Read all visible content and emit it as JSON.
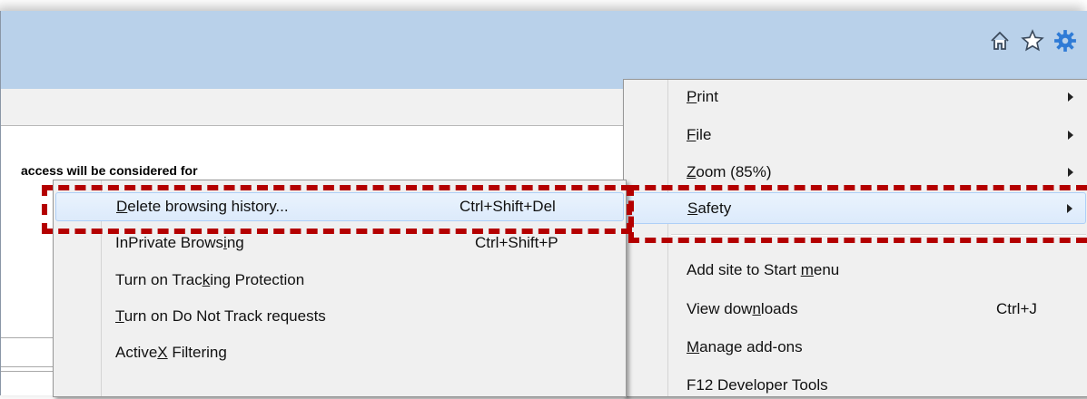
{
  "page": {
    "text": "access will be considered for"
  },
  "toolbar": {
    "icons": [
      "home-icon",
      "star-icon",
      "gear-icon"
    ]
  },
  "menu": {
    "items": [
      {
        "label": "Print",
        "submenu": true
      },
      {
        "label": "File",
        "submenu": true
      },
      {
        "label": "Zoom (85%)",
        "submenu": true
      },
      {
        "label": "Safety",
        "submenu": true
      },
      {
        "label": "Add site to Start menu"
      },
      {
        "label": "View downloads",
        "shortcut": "Ctrl+J"
      },
      {
        "label": "Manage add-ons"
      },
      {
        "label": "F12 Developer Tools"
      }
    ]
  },
  "submenu": {
    "items": [
      {
        "label": "Delete browsing history...",
        "shortcut": "Ctrl+Shift+Del"
      },
      {
        "label": "InPrivate Browsing",
        "shortcut": "Ctrl+Shift+P"
      },
      {
        "label": "Turn on Tracking Protection"
      },
      {
        "label": "Turn on Do Not Track requests"
      },
      {
        "label": "ActiveX Filtering"
      }
    ]
  },
  "colors": {
    "titlebar": "#b9d1ea",
    "highlight": "#dceafb",
    "callout": "#b40000",
    "gear": "#2f7bd6"
  }
}
